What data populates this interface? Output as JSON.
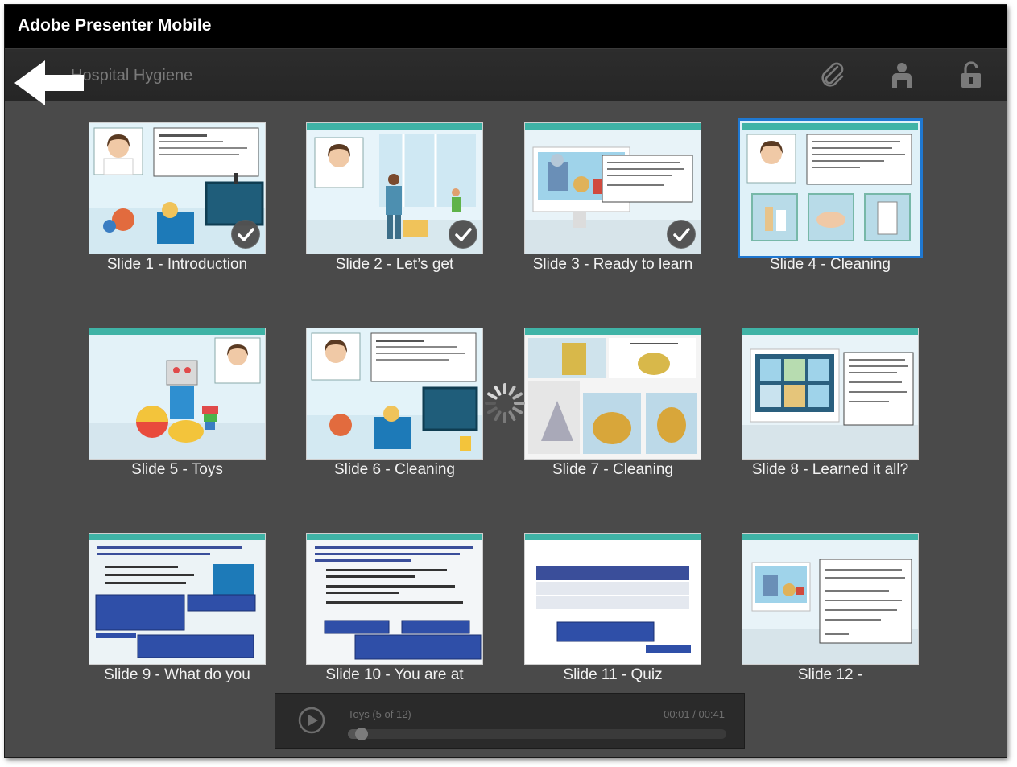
{
  "app": {
    "title": "Adobe Presenter Mobile"
  },
  "nav": {
    "course_title": "Hospital Hygiene"
  },
  "slides": [
    {
      "label": "Slide 1 - Introduction",
      "viewed": true
    },
    {
      "label": "Slide 2 - Let’s get",
      "viewed": true
    },
    {
      "label": "Slide 3 - Ready to learn",
      "viewed": true
    },
    {
      "label": "Slide 4 - Cleaning",
      "viewed": false,
      "selected": true
    },
    {
      "label": "Slide 5 - Toys",
      "viewed": false
    },
    {
      "label": "Slide 6 - Cleaning",
      "viewed": false
    },
    {
      "label": "Slide 7 - Cleaning",
      "viewed": false
    },
    {
      "label": "Slide 8 - Learned it all?",
      "viewed": false
    },
    {
      "label": "Slide 9 - What do you",
      "viewed": false
    },
    {
      "label": "Slide 10 - You are at",
      "viewed": false
    },
    {
      "label": "Slide 11 - Quiz",
      "viewed": false
    },
    {
      "label": "Slide 12 -",
      "viewed": false
    }
  ],
  "player": {
    "now_playing": "Toys (5 of 12)",
    "time": "00:01 / 00:41",
    "progress": 0.02
  },
  "icons": {
    "back": "back-arrow-icon",
    "attachment": "paperclip-icon",
    "presenter": "person-icon",
    "lock": "lock-icon",
    "play": "play-icon",
    "viewed": "checkmark-icon",
    "loading": "spinner-icon"
  },
  "colors": {
    "selected_border": "#1f78d1",
    "slide_header": "#3fb3a6"
  }
}
